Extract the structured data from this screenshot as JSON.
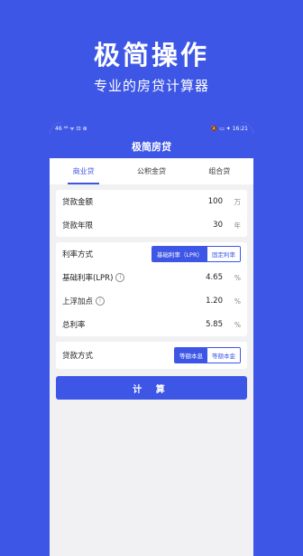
{
  "hero": {
    "title": "极简操作",
    "subtitle": "专业的房贷计算器"
  },
  "status": {
    "left": "46 ⁴⁶ ᯤ ⊡ ⊛",
    "right": "🔕 ▭ ✦ 16:21"
  },
  "app": {
    "title": "极简房贷"
  },
  "tabs": [
    "商业贷",
    "公积金贷",
    "组合贷"
  ],
  "loan": {
    "amount_label": "贷款金额",
    "amount_value": "100",
    "amount_unit": "万",
    "years_label": "贷款年限",
    "years_value": "30",
    "years_unit": "年"
  },
  "rate": {
    "mode_label": "利率方式",
    "mode_options": [
      "基础利率（LPR）",
      "固定利率"
    ],
    "base_label": "基础利率(LPR)",
    "base_value": "4.65",
    "base_unit": "%",
    "float_label": "上浮加点",
    "float_value": "1.20",
    "float_unit": "%",
    "total_label": "总利率",
    "total_value": "5.85",
    "total_unit": "%"
  },
  "repay": {
    "label": "贷款方式",
    "options": [
      "等额本息",
      "等额本金"
    ]
  },
  "calc_button": "计 算"
}
